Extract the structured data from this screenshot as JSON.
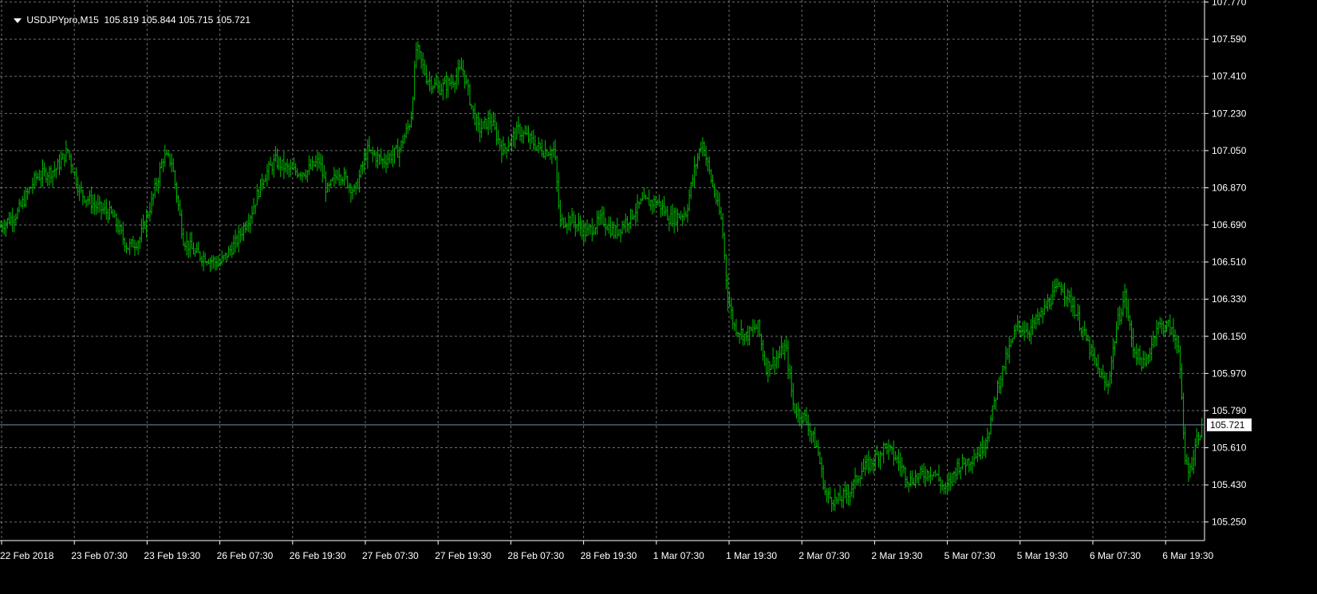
{
  "header": {
    "symbol": "USDJPYpro,M15",
    "ohlc": "105.819 105.844 105.715 105.721"
  },
  "chart_data": {
    "type": "bar",
    "symbol": "USDJPYpro",
    "timeframe": "M15",
    "ylim": [
      105.16,
      107.78
    ],
    "y_ticks": [
      "107.770",
      "107.590",
      "107.410",
      "107.230",
      "107.050",
      "106.870",
      "106.690",
      "106.510",
      "106.330",
      "106.150",
      "105.970",
      "105.790",
      "105.610",
      "105.430",
      "105.250"
    ],
    "x_ticks": [
      "22 Feb 2018",
      "23 Feb 07:30",
      "23 Feb 19:30",
      "26 Feb 07:30",
      "26 Feb 19:30",
      "27 Feb 07:30",
      "27 Feb 19:30",
      "28 Feb 07:30",
      "28 Feb 19:30",
      "1 Mar 07:30",
      "1 Mar 19:30",
      "2 Mar 07:30",
      "2 Mar 19:30",
      "5 Mar 07:30",
      "5 Mar 19:30",
      "6 Mar 07:30",
      "6 Mar 19:30"
    ],
    "current_price": "105.721",
    "grid": true,
    "colors": {
      "background": "#000000",
      "bars": "#00c000",
      "grid": "#c8c8c8",
      "axis": "#ffffff",
      "price_line": "#6f8fa8"
    },
    "close_path": [
      [
        0,
        106.68
      ],
      [
        22,
        106.75
      ],
      [
        45,
        106.92
      ],
      [
        70,
        106.96
      ],
      [
        85,
        107.05
      ],
      [
        100,
        106.85
      ],
      [
        120,
        106.78
      ],
      [
        140,
        106.74
      ],
      [
        160,
        106.58
      ],
      [
        175,
        106.62
      ],
      [
        190,
        106.8
      ],
      [
        205,
        107.02
      ],
      [
        215,
        107.0
      ],
      [
        230,
        106.62
      ],
      [
        245,
        106.55
      ],
      [
        260,
        106.53
      ],
      [
        275,
        106.5
      ],
      [
        295,
        106.6
      ],
      [
        315,
        106.75
      ],
      [
        330,
        106.92
      ],
      [
        345,
        107.0
      ],
      [
        365,
        106.95
      ],
      [
        385,
        106.95
      ],
      [
        400,
        107.0
      ],
      [
        410,
        106.85
      ],
      [
        425,
        106.95
      ],
      [
        445,
        106.85
      ],
      [
        460,
        107.05
      ],
      [
        480,
        107.0
      ],
      [
        500,
        107.05
      ],
      [
        515,
        107.2
      ],
      [
        522,
        107.55
      ],
      [
        535,
        107.4
      ],
      [
        550,
        107.35
      ],
      [
        565,
        107.38
      ],
      [
        580,
        107.45
      ],
      [
        592,
        107.25
      ],
      [
        600,
        107.15
      ],
      [
        615,
        107.2
      ],
      [
        630,
        107.05
      ],
      [
        650,
        107.15
      ],
      [
        665,
        107.1
      ],
      [
        680,
        107.05
      ],
      [
        695,
        107.05
      ],
      [
        702,
        106.7
      ],
      [
        715,
        106.72
      ],
      [
        735,
        106.65
      ],
      [
        755,
        106.72
      ],
      [
        770,
        106.65
      ],
      [
        790,
        106.73
      ],
      [
        805,
        106.8
      ],
      [
        825,
        106.8
      ],
      [
        840,
        106.72
      ],
      [
        860,
        106.75
      ],
      [
        870,
        106.95
      ],
      [
        880,
        107.1
      ],
      [
        892,
        106.9
      ],
      [
        905,
        106.7
      ],
      [
        912,
        106.35
      ],
      [
        920,
        106.2
      ],
      [
        935,
        106.15
      ],
      [
        950,
        106.2
      ],
      [
        960,
        106.0
      ],
      [
        975,
        106.05
      ],
      [
        985,
        106.1
      ],
      [
        995,
        105.8
      ],
      [
        1010,
        105.75
      ],
      [
        1025,
        105.6
      ],
      [
        1035,
        105.38
      ],
      [
        1050,
        105.35
      ],
      [
        1065,
        105.4
      ],
      [
        1080,
        105.5
      ],
      [
        1095,
        105.55
      ],
      [
        1110,
        105.62
      ],
      [
        1125,
        105.55
      ],
      [
        1140,
        105.45
      ],
      [
        1155,
        105.48
      ],
      [
        1170,
        105.5
      ],
      [
        1185,
        105.4
      ],
      [
        1200,
        105.52
      ],
      [
        1215,
        105.55
      ],
      [
        1230,
        105.6
      ],
      [
        1240,
        105.7
      ],
      [
        1250,
        105.9
      ],
      [
        1262,
        106.05
      ],
      [
        1275,
        106.2
      ],
      [
        1290,
        106.18
      ],
      [
        1305,
        106.25
      ],
      [
        1320,
        106.35
      ],
      [
        1330,
        106.4
      ],
      [
        1345,
        106.3
      ],
      [
        1360,
        106.15
      ],
      [
        1375,
        106.0
      ],
      [
        1388,
        105.9
      ],
      [
        1400,
        106.2
      ],
      [
        1410,
        106.35
      ],
      [
        1420,
        106.1
      ],
      [
        1435,
        106.0
      ],
      [
        1450,
        106.2
      ],
      [
        1465,
        106.2
      ],
      [
        1478,
        106.1
      ],
      [
        1485,
        105.55
      ],
      [
        1492,
        105.5
      ],
      [
        1500,
        105.65
      ],
      [
        1510,
        105.75
      ]
    ]
  }
}
